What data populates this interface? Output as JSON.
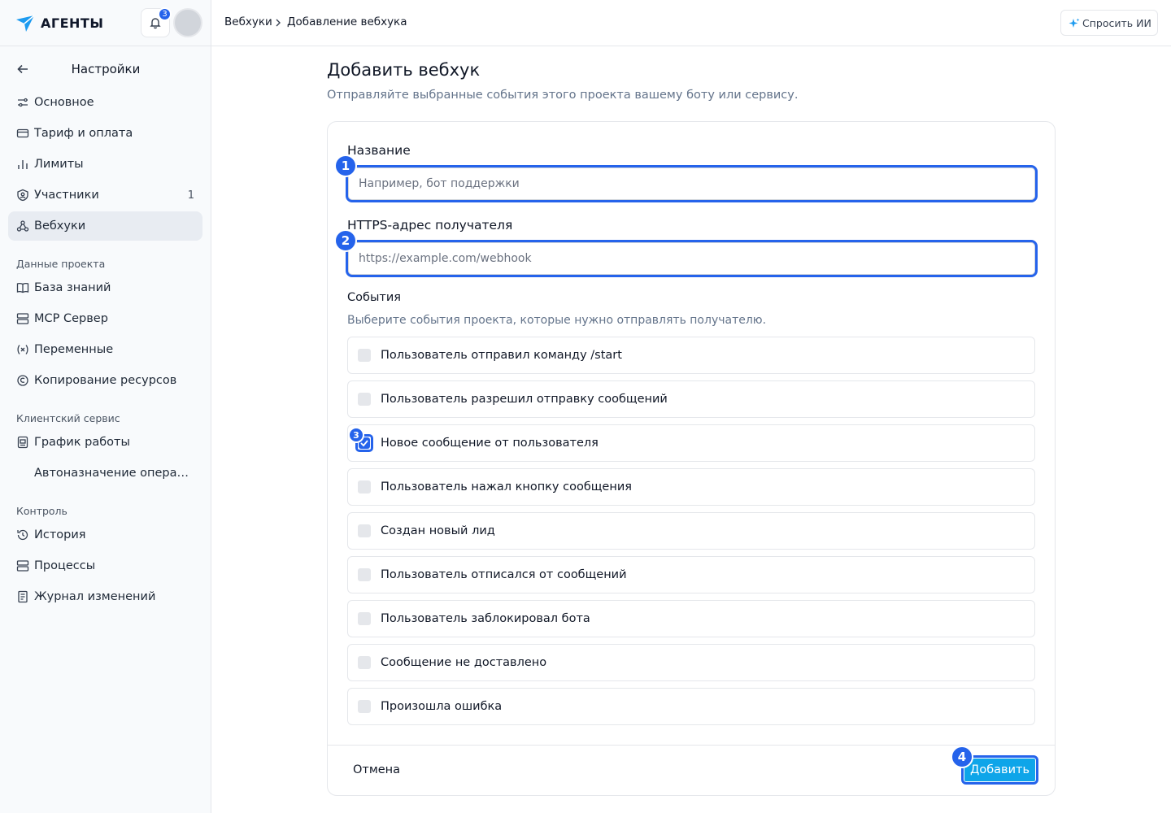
{
  "app": {
    "logo_text": "АГЕНТЫ",
    "notifications_count": "3"
  },
  "sidebar": {
    "title": "Настройки",
    "items": [
      {
        "label": "Основное",
        "icon": "sliders-icon"
      },
      {
        "label": "Тариф и оплата",
        "icon": "credit-card-icon"
      },
      {
        "label": "Лимиты",
        "icon": "bar-chart-icon"
      },
      {
        "label": "Участники",
        "icon": "user-shield-icon",
        "count": "1"
      },
      {
        "label": "Вебхуки",
        "icon": "webhook-icon",
        "active": true
      }
    ],
    "sections": [
      {
        "title": "Данные проекта",
        "items": [
          {
            "label": "База знаний",
            "icon": "book-icon"
          },
          {
            "label": "MCP Сервер",
            "icon": "server-icon"
          },
          {
            "label": "Переменные",
            "icon": "variable-icon"
          },
          {
            "label": "Копирование ресурсов",
            "icon": "copy-icon"
          }
        ]
      },
      {
        "title": "Клиентский сервис",
        "items": [
          {
            "label": "График работы",
            "icon": "calendar-icon"
          },
          {
            "label": "Автоназначение операторов",
            "icon": "assign-icon"
          }
        ]
      },
      {
        "title": "Контроль",
        "items": [
          {
            "label": "История",
            "icon": "history-icon"
          },
          {
            "label": "Процессы",
            "icon": "layers-icon"
          },
          {
            "label": "Журнал изменений",
            "icon": "log-icon"
          }
        ]
      }
    ]
  },
  "topbar": {
    "breadcrumb": [
      "Вебхуки",
      "Добавление вебхука"
    ],
    "ask_ai_label": "Спросить ИИ"
  },
  "main": {
    "title": "Добавить вебхук",
    "subtitle": "Отправляйте выбранные события этого проекта вашему боту или сервису.",
    "name_label": "Название",
    "name_placeholder": "Например, бот поддержки",
    "name_value": "",
    "url_label": "HTTPS-адрес получателя",
    "url_placeholder": "https://example.com/webhook",
    "url_value": "",
    "events_title": "События",
    "events_subtitle": "Выберите события проекта, которые нужно отправлять получателю.",
    "events": [
      {
        "label": "Пользователь отправил команду /start",
        "checked": false
      },
      {
        "label": "Пользователь разрешил отправку сообщений",
        "checked": false
      },
      {
        "label": "Новое сообщение от пользователя",
        "checked": true
      },
      {
        "label": "Пользователь нажал кнопку сообщения",
        "checked": false
      },
      {
        "label": "Создан новый лид",
        "checked": false
      },
      {
        "label": "Пользователь отписался от сообщений",
        "checked": false
      },
      {
        "label": "Пользователь заблокировал бота",
        "checked": false
      },
      {
        "label": "Сообщение не доставлено",
        "checked": false
      },
      {
        "label": "Произошла ошибка",
        "checked": false
      }
    ],
    "cancel_label": "Отмена",
    "submit_label": "Добавить"
  },
  "annotations": [
    "1",
    "2",
    "3",
    "4"
  ],
  "colors": {
    "accent": "#2563eb",
    "submit": "#0ea5e9",
    "active_nav": "#e8ecf2"
  }
}
